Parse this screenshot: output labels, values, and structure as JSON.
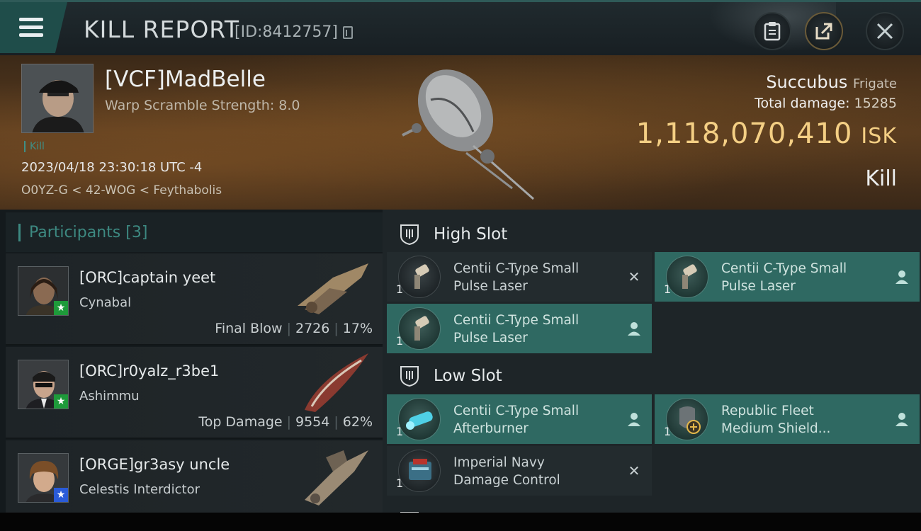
{
  "header": {
    "title": "KILL REPORT",
    "report_id": "[ID:8412757]",
    "menu_icon": "hamburger-icon",
    "buttons": {
      "clipboard_icon": "clipboard-icon",
      "share_icon": "share-icon",
      "close_icon": "close-icon"
    }
  },
  "victim": {
    "name": "[VCF]MadBelle",
    "warp_scramble": "Warp Scramble Strength: 8.0",
    "tag": "Kill",
    "time": "2023/04/18 23:30:18 UTC -4",
    "location": "O0YZ-G < 42-WOG < Feythabolis",
    "ship": "Succubus",
    "ship_class": "Frigate",
    "total_damage_label": "Total damage:",
    "total_damage": "15285",
    "isk_value": "1,118,070,410",
    "isk_unit": "ISK",
    "result": "Kill"
  },
  "participants": {
    "title": "Participants",
    "count": "[3]",
    "list": [
      {
        "name": "[ORC]captain yeet",
        "ship": "Cynabal",
        "role": "Final Blow",
        "damage": "2726",
        "percent": "17%",
        "badge_color": "#1e9a3a",
        "badge_icon": "star-icon"
      },
      {
        "name": "[ORC]r0yalz_r3be1",
        "ship": "Ashimmu",
        "role": "Top Damage",
        "damage": "9554",
        "percent": "62%",
        "badge_color": "#1e9a3a",
        "badge_icon": "star-icon"
      },
      {
        "name": "[ORGE]gr3asy uncle",
        "ship": "Celestis Interdictor",
        "role": "",
        "damage": "",
        "percent": "",
        "badge_color": "#2a5bd8",
        "badge_icon": "star-icon"
      }
    ]
  },
  "fitting": {
    "high_slot": {
      "label": "High Slot",
      "modules": [
        {
          "line1": "Centii C-Type Small",
          "line2": "Pulse Laser",
          "qty": "1",
          "status": "destroyed",
          "status_icon": "close-icon"
        },
        {
          "line1": "Centii C-Type Small",
          "line2": "Pulse Laser",
          "qty": "1",
          "status": "dropped",
          "status_icon": "person-icon"
        },
        {
          "line1": "Centii C-Type Small",
          "line2": "Pulse Laser",
          "qty": "1",
          "status": "dropped",
          "status_icon": "person-icon"
        }
      ]
    },
    "low_slot": {
      "label": "Low Slot",
      "modules": [
        {
          "line1": "Centii C-Type Small",
          "line2": "Afterburner",
          "qty": "1",
          "status": "dropped",
          "status_icon": "person-icon"
        },
        {
          "line1": "Republic Fleet",
          "line2": "Medium Shield...",
          "qty": "1",
          "status": "dropped",
          "status_icon": "person-icon"
        },
        {
          "line1": "Imperial Navy",
          "line2": "Damage Control",
          "qty": "1",
          "status": "destroyed",
          "status_icon": "close-icon"
        }
      ]
    }
  },
  "colors": {
    "accent": "#2f6962",
    "isk": "#f4cf84",
    "participants_title": "#3d8981"
  }
}
